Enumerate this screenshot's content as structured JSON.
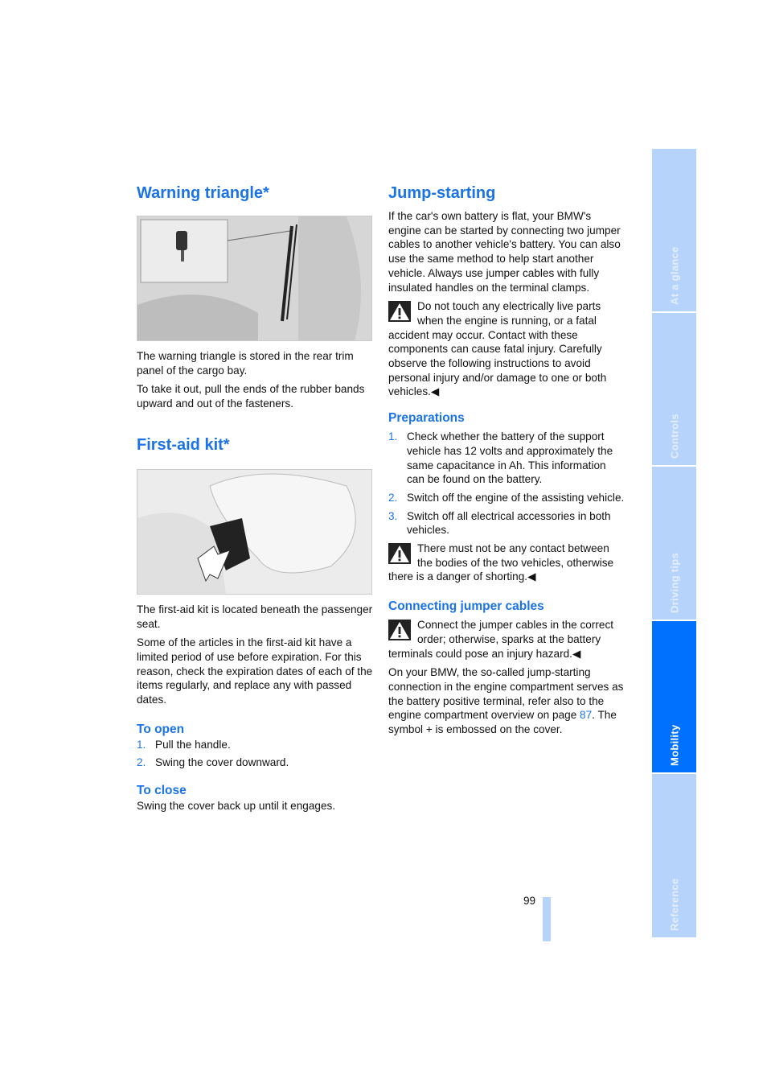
{
  "left": {
    "warning_triangle": {
      "title": "Warning triangle*",
      "paragraphs": [
        "The warning triangle is stored in the rear trim panel of the cargo bay.",
        "To take it out, pull the ends of the rubber bands upward and out of the fasteners."
      ]
    },
    "first_aid": {
      "title": "First-aid kit*",
      "paragraphs": [
        "The first-aid kit is located beneath the passenger seat.",
        "Some of the articles in the first-aid kit have a limited period of use before expiration. For this reason, check the expiration dates of each of the items regularly, and replace any with passed dates."
      ],
      "to_open": {
        "title": "To open",
        "steps": [
          "Pull the handle.",
          "Swing the cover downward."
        ]
      },
      "to_close": {
        "title": "To close",
        "text": "Swing the cover back up until it engages."
      }
    }
  },
  "right": {
    "title": "Jump-starting",
    "intro": "If the car's own battery is flat, your BMW's engine can be started by connecting two jumper cables to another vehicle's battery. You can also use the same method to help start another vehicle. Always use jumper cables with fully insulated handles on the terminal clamps.",
    "warning1": "Do not touch any electrically live parts when the engine is running, or a fatal accident may occur. Contact with these components can cause fatal injury. Carefully observe the following instructions to avoid personal injury and/or damage to one or both vehicles.",
    "preparations": {
      "title": "Preparations",
      "steps": [
        "Check whether the battery of the support vehicle has 12 volts and approximately the same capacitance in Ah. This information can be found on the battery.",
        "Switch off the engine of the assisting vehicle.",
        "Switch off all electrical accessories in both vehicles."
      ],
      "warning": "There must not be any contact between the bodies of the two vehicles, otherwise there is a danger of shorting."
    },
    "connecting": {
      "title": "Connecting jumper cables",
      "warning": "Connect the jumper cables in the correct order; otherwise, sparks at the battery terminals could pose an injury hazard.",
      "text_before": "On your BMW, the so-called jump-starting connection in the engine compartment serves as the battery positive terminal, refer also to the engine compartment overview on page ",
      "page_link": "87",
      "text_after": ". The symbol + is embossed on the cover."
    }
  },
  "end_mark": "◀",
  "page_number": "99",
  "sidebar": {
    "tabs": [
      {
        "label": "At a glance",
        "active": false
      },
      {
        "label": "Controls",
        "active": false
      },
      {
        "label": "Driving tips",
        "active": false
      },
      {
        "label": "Mobility",
        "active": true
      },
      {
        "label": "Reference",
        "active": false
      }
    ]
  },
  "colors": {
    "accent": "#1a73e8",
    "tab_active": "#0070ff",
    "tab_inactive": "#b5d3fb"
  }
}
